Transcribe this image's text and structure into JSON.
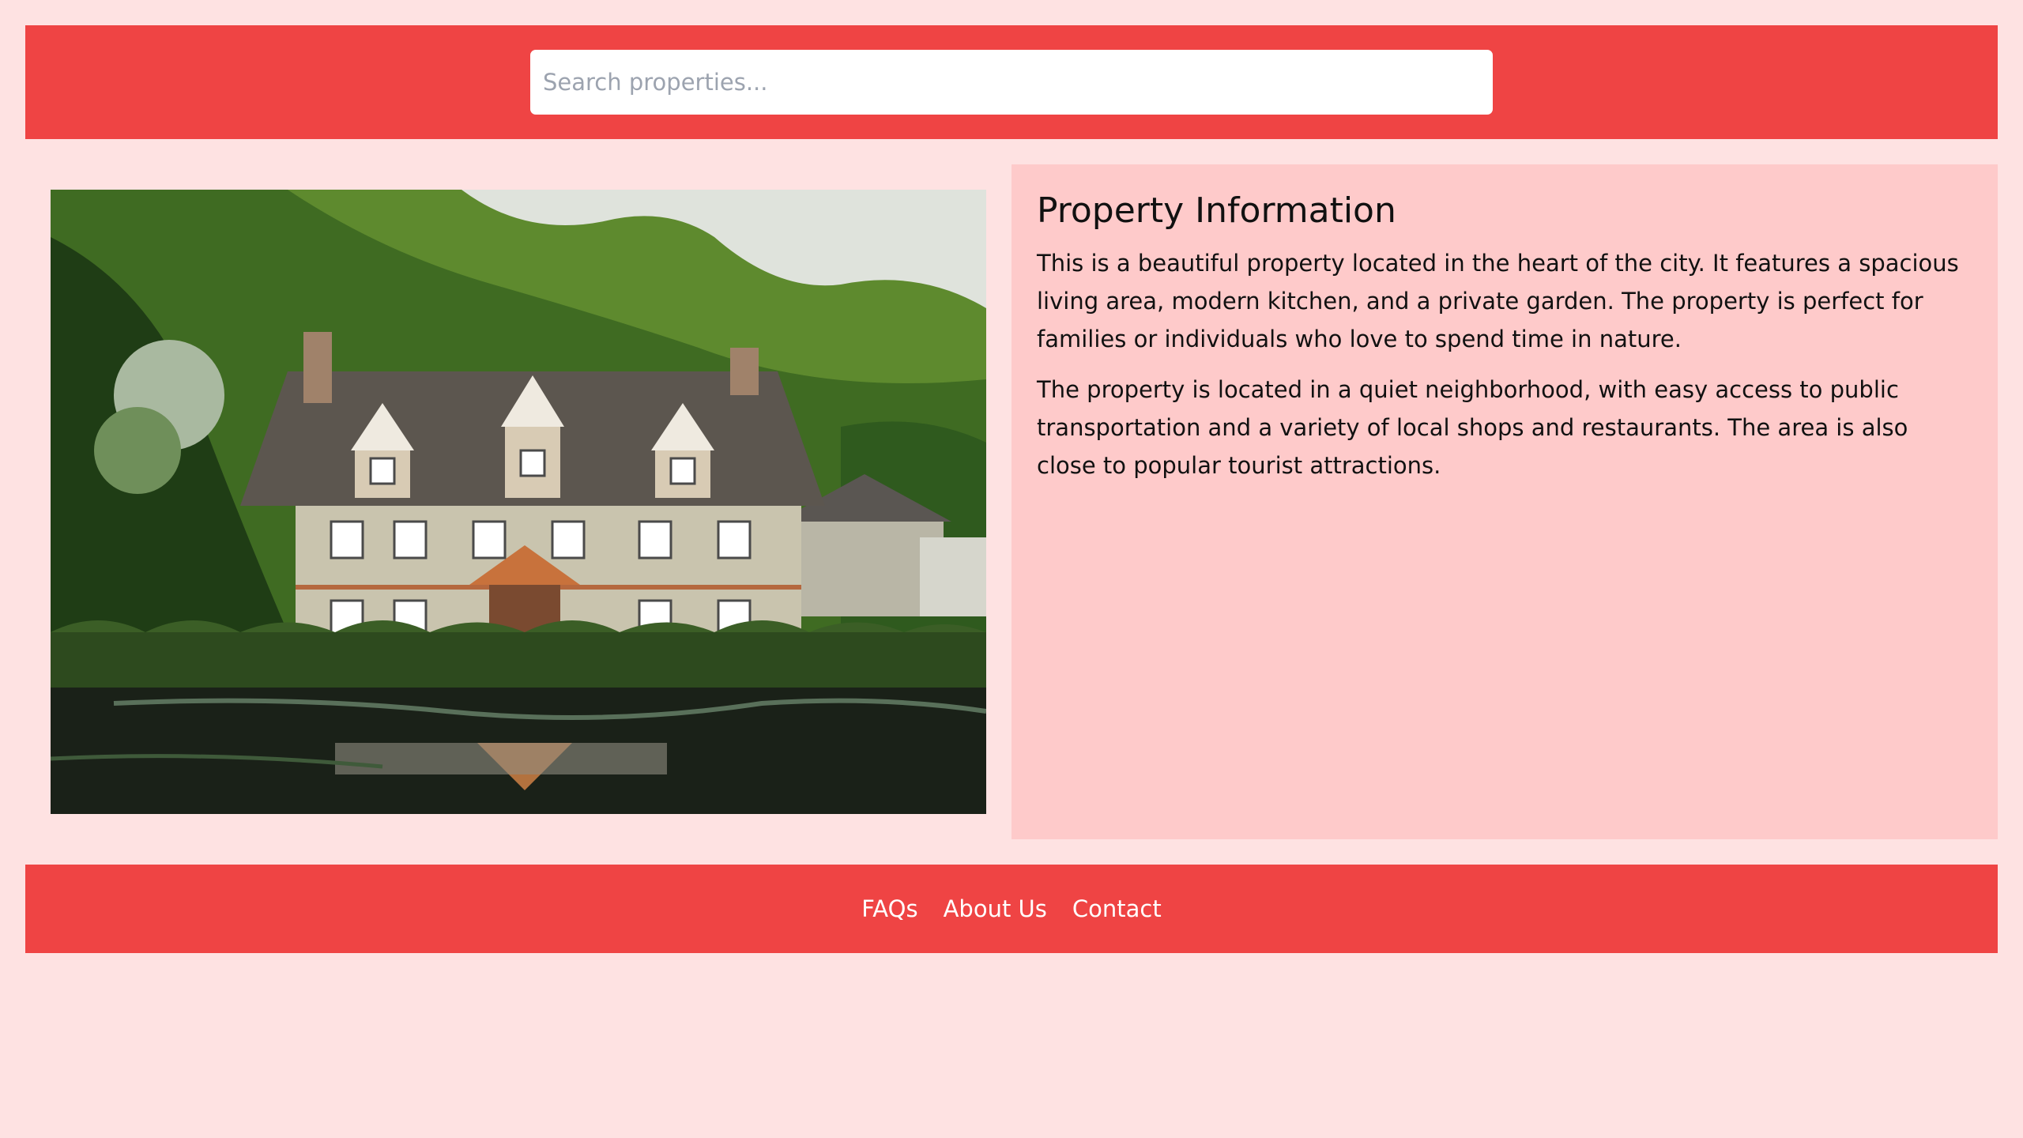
{
  "search": {
    "placeholder": "Search properties..."
  },
  "property": {
    "title": "Property Information",
    "paragraphs": [
      "This is a beautiful property located in the heart of the city. It features a spacious living area, modern kitchen, and a private garden. The property is perfect for families or individuals who love to spend time in nature.",
      "The property is located in a quiet neighborhood, with easy access to public transportation and a variety of local shops and restaurants. The area is also close to popular tourist attractions."
    ]
  },
  "footer": {
    "links": [
      "FAQs",
      "About Us",
      "Contact"
    ]
  },
  "colors": {
    "background": "#fee2e2",
    "accent": "#ef4444",
    "panel": "#fecaca"
  }
}
